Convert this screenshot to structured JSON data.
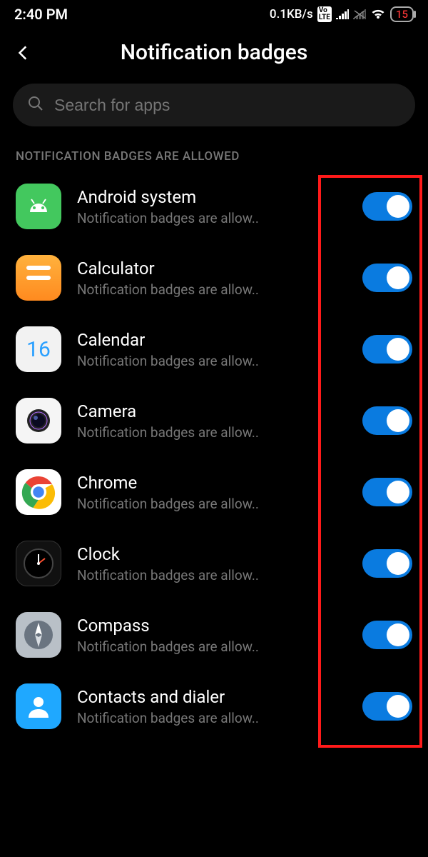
{
  "status": {
    "time": "2:40 PM",
    "net_speed": "0.1KB/s",
    "volte": "Vo LTE",
    "battery": "15"
  },
  "header": {
    "title": "Notification badges"
  },
  "search": {
    "placeholder": "Search for apps"
  },
  "section_label": "NOTIFICATION BADGES ARE ALLOWED",
  "apps": [
    {
      "name": "Android system",
      "sub": "Notification badges are allow..",
      "on": true,
      "icon": "android"
    },
    {
      "name": "Calculator",
      "sub": "Notification badges are allow..",
      "on": true,
      "icon": "calculator"
    },
    {
      "name": "Calendar",
      "sub": "Notification badges are allow..",
      "on": true,
      "icon": "calendar",
      "cal_day": "16"
    },
    {
      "name": "Camera",
      "sub": "Notification badges are allow..",
      "on": true,
      "icon": "camera"
    },
    {
      "name": "Chrome",
      "sub": "Notification badges are allow..",
      "on": true,
      "icon": "chrome"
    },
    {
      "name": "Clock",
      "sub": "Notification badges are allow..",
      "on": true,
      "icon": "clock"
    },
    {
      "name": "Compass",
      "sub": "Notification badges are allow..",
      "on": true,
      "icon": "compass"
    },
    {
      "name": "Contacts and dialer",
      "sub": "Notification badges are allow..",
      "on": true,
      "icon": "contacts"
    }
  ]
}
